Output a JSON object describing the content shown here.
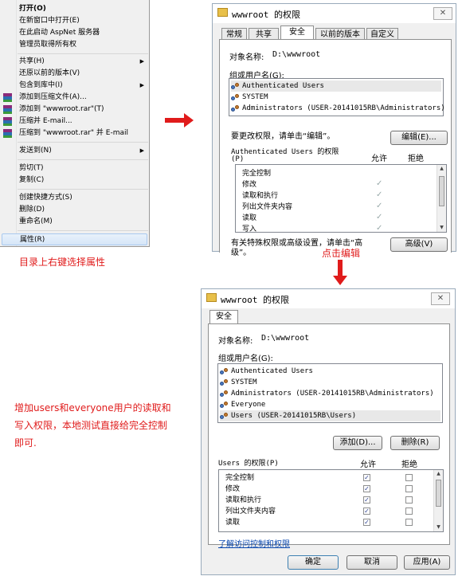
{
  "context_menu": {
    "items": [
      {
        "label": "打开(O)",
        "bold": true
      },
      {
        "label": "在新窗口中打开(E)"
      },
      {
        "label": "在此启动 AspNet 服务器"
      },
      {
        "label": "管理员取得所有权"
      },
      {
        "label": "共享(H)",
        "submenu": true
      },
      {
        "label": "还原以前的版本(V)"
      },
      {
        "label": "包含到库中(I)",
        "submenu": true
      },
      {
        "label": "添加到压缩文件(A)...",
        "icon": "winrar-icon"
      },
      {
        "label": "添加到 \"wwwroot.rar\"(T)",
        "icon": "winrar-icon"
      },
      {
        "label": "压缩并 E-mail...",
        "icon": "winrar-icon"
      },
      {
        "label": "压缩到 \"wwwroot.rar\" 并 E-mail",
        "icon": "winrar-icon"
      },
      {
        "label": "发送到(N)",
        "submenu": true
      },
      {
        "label": "剪切(T)"
      },
      {
        "label": "复制(C)"
      },
      {
        "label": "创建快捷方式(S)"
      },
      {
        "label": "删除(D)"
      },
      {
        "label": "重命名(M)"
      },
      {
        "label": "属性(R)",
        "highlighted": true
      }
    ]
  },
  "annotations": {
    "step1": "目录上右键选择属性",
    "step2": "点击编辑",
    "step3_line1": "增加users和everyone用户的读取和",
    "step3_line2": "写入权限，本地测试直接给完全控制",
    "step3_line3": "即可."
  },
  "dialog1": {
    "title": "wwwroot 的权限",
    "close": "✕",
    "tabs": [
      "常规",
      "共享",
      "安全",
      "以前的版本",
      "自定义"
    ],
    "active_tab": "安全",
    "object_label": "对象名称:",
    "object_value": "D:\\wwwroot",
    "group_label": "组或用户名(G):",
    "users": [
      "Authenticated Users",
      "SYSTEM",
      "Administrators (USER-20141015RB\\Administrators)"
    ],
    "change_hint": "要更改权限，请单击“编辑”。",
    "edit_button": "编辑(E)...",
    "perm_title_line1": "Authenticated Users 的权限",
    "perm_title_line2": "(P)",
    "col_allow": "允许",
    "col_deny": "拒绝",
    "permissions": [
      "完全控制",
      "修改",
      "读取和执行",
      "列出文件夹内容",
      "读取",
      "写入"
    ],
    "allowed_grey": [
      false,
      true,
      true,
      true,
      true,
      true
    ],
    "advanced_hint_line1": "有关特殊权限或高级设置，请单击“高",
    "advanced_hint_line2": "级”。",
    "advanced_button": "高级(V)"
  },
  "dialog2": {
    "title": "wwwroot 的权限",
    "close": "✕",
    "tab": "安全",
    "object_label": "对象名称:",
    "object_value": "D:\\wwwroot",
    "group_label": "组或用户名(G):",
    "users": [
      "Authenticated Users",
      "SYSTEM",
      "Administrators (USER-20141015RB\\Administrators)",
      "Everyone",
      "Users (USER-20141015RB\\Users)"
    ],
    "add_button": "添加(D)...",
    "remove_button": "删除(R)",
    "perm_title": "Users 的权限(P)",
    "col_allow": "允许",
    "col_deny": "拒绝",
    "permissions": [
      "完全控制",
      "修改",
      "读取和执行",
      "列出文件夹内容",
      "读取"
    ],
    "allow_checked": [
      true,
      true,
      true,
      true,
      true
    ],
    "deny_checked": [
      false,
      false,
      false,
      false,
      false
    ],
    "link": "了解访问控制和权限",
    "ok_button": "确定",
    "cancel_button": "取消",
    "apply_button": "应用(A)"
  },
  "colors": {
    "annotation_red": "#e01b1b",
    "highlight": "#d6e6f8"
  }
}
